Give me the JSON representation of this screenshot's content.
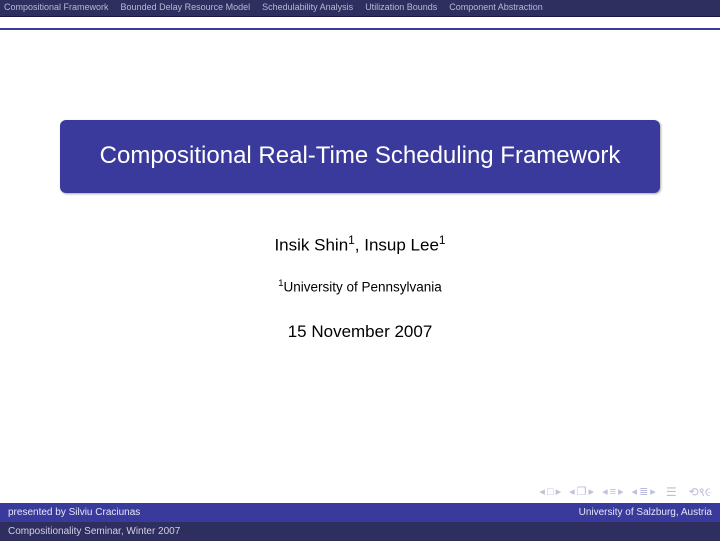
{
  "nav": {
    "items": [
      "Compositional Framework",
      "Bounded Delay Resource Model",
      "Schedulability Analysis",
      "Utilization Bounds",
      "Component Abstraction"
    ]
  },
  "title": "Compositional Real-Time Scheduling Framework",
  "authors": {
    "a1_name": "Insik Shin",
    "a1_sup": "1",
    "sep": ", ",
    "a2_name": "Insup Lee",
    "a2_sup": "1"
  },
  "affiliation": {
    "sup": "1",
    "text": "University of Pennsylvania"
  },
  "date": "15 November 2007",
  "footer": {
    "presenter": "presented by Silviu Craciunas",
    "institution": "University of Salzburg, Austria",
    "seminar": "Compositionality Seminar, Winter 2007"
  }
}
